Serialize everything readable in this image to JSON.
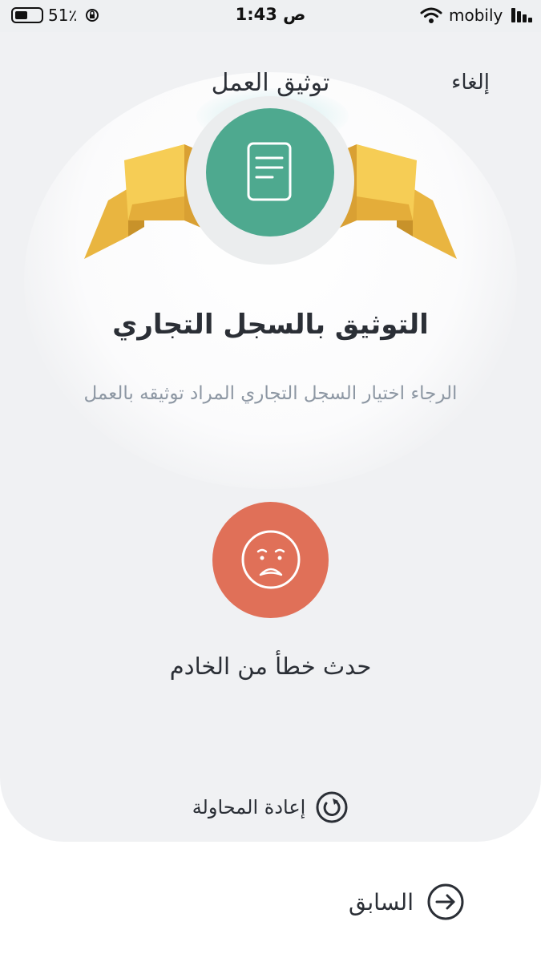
{
  "status_bar": {
    "battery_percent": "51٪",
    "time": "1:43 ص",
    "carrier": "mobily",
    "icons": [
      "battery-icon",
      "rotation-lock-icon",
      "wifi-icon",
      "signal-icon"
    ]
  },
  "header": {
    "title": "توثيق العمل",
    "cancel_label": "إلغاء"
  },
  "badge": {
    "icon": "document-icon",
    "color": "#4ea98f"
  },
  "content": {
    "title": "التوثيق بالسجل التجاري",
    "subtitle": "الرجاء اختيار السجل التجاري المراد توثيقه بالعمل"
  },
  "error": {
    "icon": "sad-face-icon",
    "color": "#e07058",
    "message": "حدث خطأ من الخادم"
  },
  "actions": {
    "retry_label": "إعادة المحاولة",
    "previous_label": "السابق"
  }
}
